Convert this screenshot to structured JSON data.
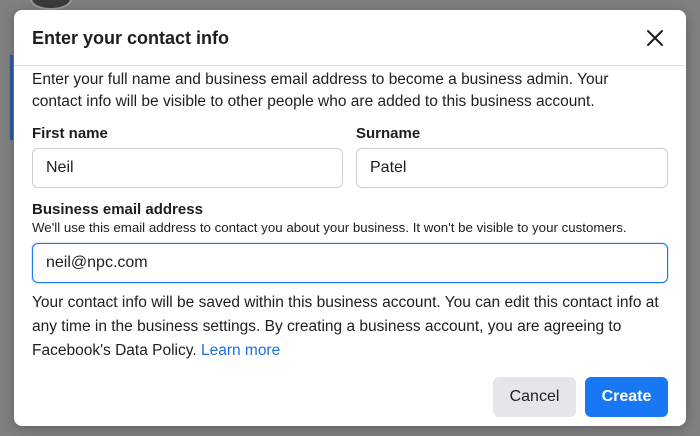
{
  "dialog": {
    "title": "Enter your contact info",
    "description": "Enter your full name and business email address to become a business admin. Your contact info will be visible to other people who are added to this business account."
  },
  "form": {
    "first_name": {
      "label": "First name",
      "value": "Neil"
    },
    "surname": {
      "label": "Surname",
      "value": "Patel"
    },
    "email": {
      "label": "Business email address",
      "hint": "We'll use this email address to contact you about your business. It won't be visible to your customers.",
      "value": "neil@npc.com"
    }
  },
  "footer": {
    "text": "Your contact info will be saved within this business account. You can edit this contact info at any time in the business settings. By creating a business account, you are agreeing to Facebook's Data Policy.",
    "link_label": "Learn more"
  },
  "buttons": {
    "cancel_label": "Cancel",
    "create_label": "Create"
  },
  "colors": {
    "accent": "#1877f2",
    "link": "#216fdb",
    "secondary_button": "#e4e6eb"
  },
  "icons": {
    "close": "close-icon"
  }
}
